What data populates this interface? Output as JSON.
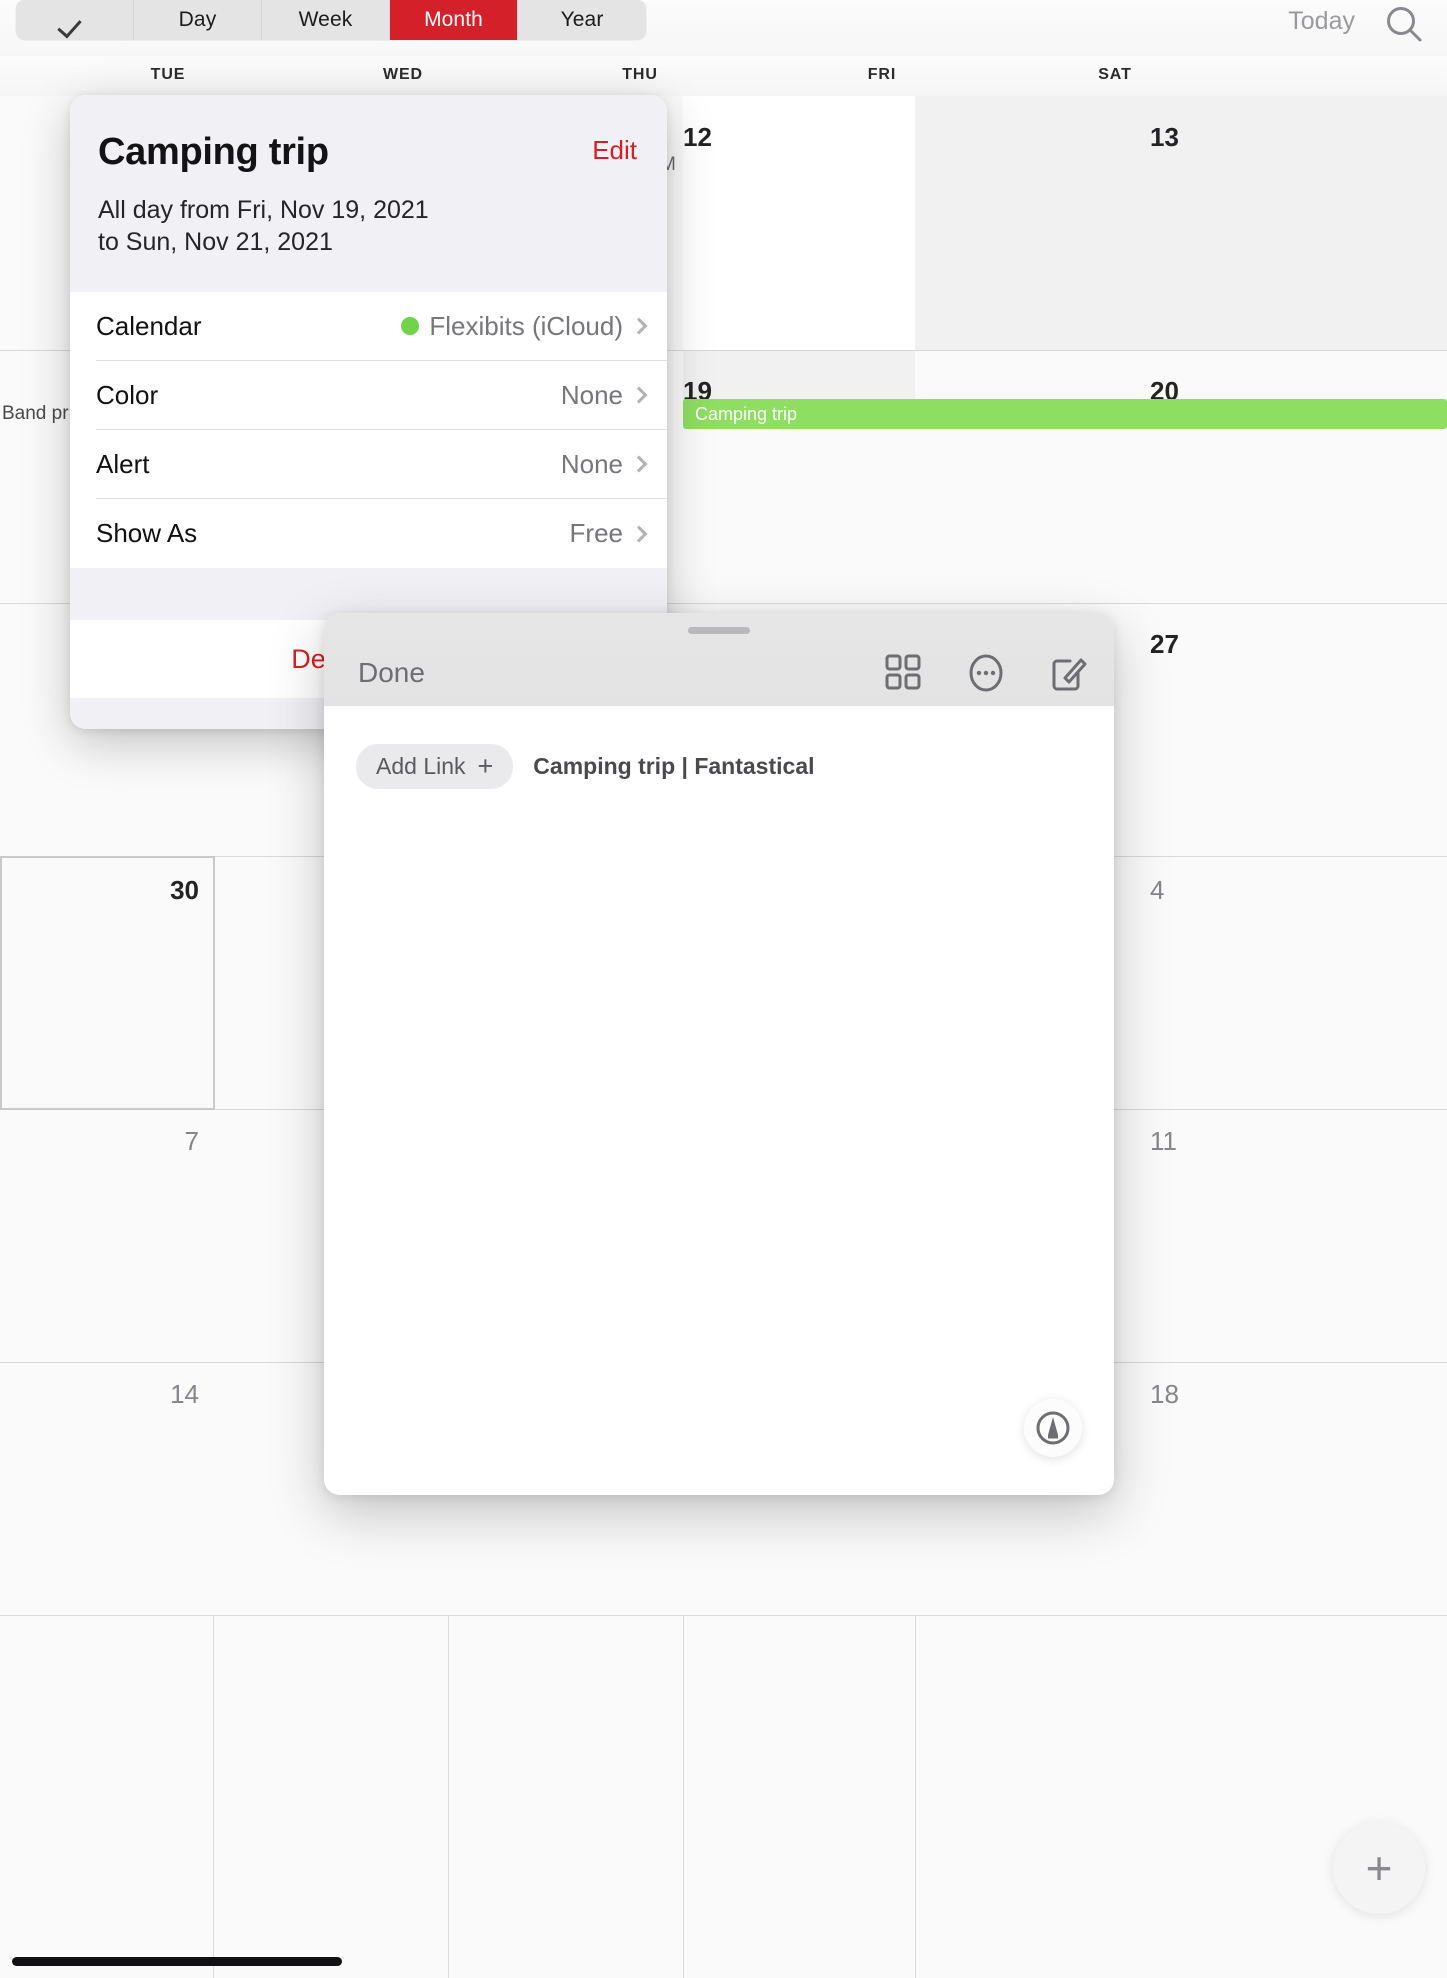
{
  "app": {
    "name": "Fantastical"
  },
  "toolbar": {
    "check_icon": "check-icon",
    "views": [
      "Day",
      "Week",
      "Month",
      "Year"
    ],
    "active_view": "Month",
    "today_label": "Today",
    "search_icon": "search-icon",
    "accent_red": "#d42028"
  },
  "calendar": {
    "weekdays": [
      "TUE",
      "WED",
      "THU",
      "FRI",
      "SAT"
    ],
    "rows": [
      {
        "days": [
          {
            "num": "",
            "muted": false
          },
          {
            "num": "",
            "muted": false
          },
          {
            "num": "",
            "muted": false
          },
          {
            "num": "12",
            "muted": false
          },
          {
            "num": "13",
            "muted": false
          }
        ]
      },
      {
        "days": [
          {
            "num": "",
            "muted": false
          },
          {
            "num": "",
            "muted": false
          },
          {
            "num": "",
            "muted": false
          },
          {
            "num": "19",
            "muted": false
          },
          {
            "num": "20",
            "muted": false
          }
        ]
      },
      {
        "days": [
          {
            "num": "",
            "muted": false
          },
          {
            "num": "",
            "muted": false
          },
          {
            "num": "",
            "muted": false
          },
          {
            "num": "",
            "muted": false
          },
          {
            "num": "27",
            "muted": false
          }
        ]
      },
      {
        "days": [
          {
            "num": "30",
            "muted": false
          },
          {
            "num": "",
            "muted": false
          },
          {
            "num": "",
            "muted": false
          },
          {
            "num": "",
            "muted": false
          },
          {
            "num": "4",
            "muted": true
          }
        ]
      },
      {
        "days": [
          {
            "num": "7",
            "muted": true
          },
          {
            "num": "",
            "muted": false
          },
          {
            "num": "",
            "muted": false
          },
          {
            "num": "",
            "muted": false
          },
          {
            "num": "11",
            "muted": true
          }
        ]
      },
      {
        "days": [
          {
            "num": "14",
            "muted": true
          },
          {
            "num": "",
            "muted": false
          },
          {
            "num": "",
            "muted": false
          },
          {
            "num": "",
            "muted": false
          },
          {
            "num": "18",
            "muted": true
          }
        ]
      }
    ],
    "events": [
      {
        "title": "Camping trip",
        "color": "#8ede62"
      }
    ],
    "partial_event": "Band pr",
    "partial_time": "M"
  },
  "popover": {
    "title": "Camping trip",
    "edit_label": "Edit",
    "subtitle_line1": "All day from Fri, Nov 19, 2021",
    "subtitle_line2": "to Sun, Nov 21, 2021",
    "rows": [
      {
        "label": "Calendar",
        "value": "Flexibits (iCloud)",
        "dot": "#6fd44a"
      },
      {
        "label": "Color",
        "value": "None",
        "dot": ""
      },
      {
        "label": "Alert",
        "value": "None",
        "dot": ""
      },
      {
        "label": "Show As",
        "value": "Free",
        "dot": ""
      }
    ],
    "delete_label": "Delete Event",
    "delete_visible": "De"
  },
  "share_sheet": {
    "done_label": "Done",
    "actions": [
      {
        "icon": "grid-icon"
      },
      {
        "icon": "more-circle-icon"
      },
      {
        "icon": "compose-icon"
      }
    ],
    "add_link_label": "Add Link",
    "add_link_plus": "+",
    "shared_item": "Camping trip | Fantastical",
    "markup_icon": "markup-pen-icon"
  },
  "fab": {
    "label": "+",
    "icon": "add-event-icon"
  }
}
